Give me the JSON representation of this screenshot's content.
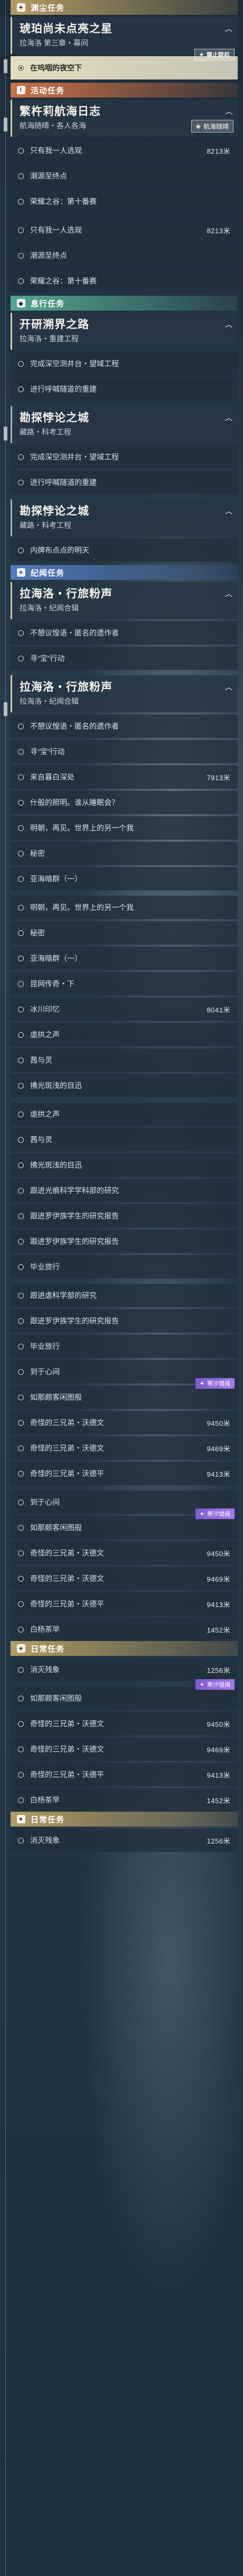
{
  "sections": [
    {
      "type": "cat",
      "style": "cat-main",
      "badge": "✦",
      "label": "渊尘任务"
    },
    {
      "type": "quest",
      "title": "琥珀尚未点亮之星",
      "sub": "拉海洛 第三章・幕间",
      "dim": false
    },
    {
      "type": "row",
      "text": "在呜咽的夜空下",
      "hl": true,
      "tag": {
        "style": "tag-white",
        "text": "禁止联机"
      }
    },
    {
      "type": "space"
    },
    {
      "type": "cat",
      "style": "cat-event",
      "badge": "!",
      "label": "活动任务"
    },
    {
      "type": "quest",
      "title": "繁杵莉航海日志",
      "sub": "航海随晴・各人各海",
      "dim": false,
      "tag": {
        "style": "tag-white",
        "text": "航海随晴"
      }
    },
    {
      "type": "row",
      "text": "只有我一人选观",
      "dist": "8213米"
    },
    {
      "type": "row",
      "text": "潮源至终点"
    },
    {
      "type": "row",
      "text": "荣耀之谷：第十番赛"
    },
    {
      "type": "space"
    },
    {
      "type": "row",
      "text": "只有我一人选观",
      "dist": "8213米"
    },
    {
      "type": "row",
      "text": "潮源至终点"
    },
    {
      "type": "row",
      "text": "荣耀之谷：第十番赛"
    },
    {
      "type": "space"
    },
    {
      "type": "cat",
      "style": "cat-daily",
      "badge": "◆",
      "label": "息行任务"
    },
    {
      "type": "quest",
      "title": "开研溯界之路",
      "sub": "拉海洛・重建工程",
      "dim": false
    },
    {
      "type": "row",
      "text": "完成深空测井台・望域工程"
    },
    {
      "type": "row",
      "text": "进行呼喊隧道的重建"
    },
    {
      "type": "space"
    },
    {
      "type": "quest",
      "title": "勘探悖论之城",
      "sub": "藏路・科考工程",
      "dim": true
    },
    {
      "type": "row",
      "text": "完成深空测井台・望域工程"
    },
    {
      "type": "row",
      "text": "进行呼喊隧道的重建"
    },
    {
      "type": "space"
    },
    {
      "type": "quest",
      "title": "勘探悖论之城",
      "sub": "藏路・科考工程",
      "dim": true
    },
    {
      "type": "row",
      "text": "内牌布点点的明天"
    },
    {
      "type": "space"
    },
    {
      "type": "cat",
      "style": "cat-comp",
      "badge": "✧",
      "label": "纪闻任务"
    },
    {
      "type": "quest",
      "title": "拉海洛・行旅粉声",
      "sub": "拉海洛・纪闻合辑",
      "dim": false
    },
    {
      "type": "row",
      "text": "不憩议惶语・匿名的遗作者"
    },
    {
      "type": "row",
      "text": "寻“宝”行动"
    },
    {
      "type": "space"
    },
    {
      "type": "quest",
      "title": "拉海洛・行旅粉声",
      "sub": "拉海洛・纪闻合辑",
      "dim": false
    },
    {
      "type": "row",
      "text": "不憩议惶语・匿名的遗作者"
    },
    {
      "type": "row",
      "text": "寻“宝”行动"
    },
    {
      "type": "row",
      "text": "来自暮白深处",
      "dist": "7913米"
    },
    {
      "type": "row",
      "text": "什般的照明。谁从睡眠会？"
    },
    {
      "type": "row",
      "text": "明朝，再见。世界上的另一个我"
    },
    {
      "type": "row",
      "text": "秘密"
    },
    {
      "type": "row",
      "text": "亚海暗群（一）"
    },
    {
      "type": "space"
    },
    {
      "type": "row",
      "text": "明朝，再见。世界上的另一个我"
    },
    {
      "type": "row",
      "text": "秘密"
    },
    {
      "type": "row",
      "text": "亚海暗群（一）"
    },
    {
      "type": "row",
      "text": "昆网传奇・下"
    },
    {
      "type": "row",
      "text": "冰川印忆",
      "dist": "8041米"
    },
    {
      "type": "row",
      "text": "虐拱之声"
    },
    {
      "type": "row",
      "text": "茜与灵"
    },
    {
      "type": "row",
      "text": "拂光斑浅的目迅"
    },
    {
      "type": "space"
    },
    {
      "type": "row",
      "text": "虐拱之声"
    },
    {
      "type": "row",
      "text": "茜与灵"
    },
    {
      "type": "row",
      "text": "拂光斑浅的目迅"
    },
    {
      "type": "row",
      "text": "跟进光痕科学学科部的研究"
    },
    {
      "type": "row",
      "text": "跟进罗伊族学生的研究报告"
    },
    {
      "type": "row",
      "text": "跟进罗伊族学生的研究报告"
    },
    {
      "type": "row",
      "text": "毕业旅行"
    },
    {
      "type": "space"
    },
    {
      "type": "row",
      "text": "跟进虐科学部的研究"
    },
    {
      "type": "row",
      "text": "跟进罗伊族学生的研究报告"
    },
    {
      "type": "row",
      "text": "毕业旅行"
    },
    {
      "type": "row",
      "text": "到于心间"
    },
    {
      "type": "row",
      "text": "如那颇客闲图般",
      "tag": {
        "style": "tag-purple",
        "text": "寒汐错阈"
      }
    },
    {
      "type": "row",
      "text": "奇怪的三兄弟・沃德文",
      "dist": "9450米"
    },
    {
      "type": "row",
      "text": "奇怪的三兄弟・沃德文",
      "dist": "9469米"
    },
    {
      "type": "row",
      "text": "奇怪的三兄弟・沃德平",
      "dist": "9413米"
    },
    {
      "type": "space"
    },
    {
      "type": "row",
      "text": "到于心间"
    },
    {
      "type": "row",
      "text": "如那颇客闲图般",
      "tag": {
        "style": "tag-purple",
        "text": "寒汐错阈"
      }
    },
    {
      "type": "row",
      "text": "奇怪的三兄弟・沃德文",
      "dist": "9450米"
    },
    {
      "type": "row",
      "text": "奇怪的三兄弟・沃德文",
      "dist": "9469米"
    },
    {
      "type": "row",
      "text": "奇怪的三兄弟・沃德平",
      "dist": "9413米"
    },
    {
      "type": "row",
      "text": "白杨茶早",
      "dist": "1452米"
    },
    {
      "type": "cat",
      "style": "cat-main",
      "badge": "✦",
      "label": "日常任务"
    },
    {
      "type": "row",
      "text": "消灭残象",
      "dist": "1256米"
    },
    {
      "type": "space"
    },
    {
      "type": "row",
      "text": "如那颇客闲图般",
      "tag": {
        "style": "tag-purple",
        "text": "寒汐错阈"
      }
    },
    {
      "type": "row",
      "text": "奇怪的三兄弟・沃德文",
      "dist": "9450米"
    },
    {
      "type": "row",
      "text": "奇怪的三兄弟・沃德文",
      "dist": "9469米"
    },
    {
      "type": "row",
      "text": "奇怪的三兄弟・沃德平",
      "dist": "9413米"
    },
    {
      "type": "row",
      "text": "白杨茶早",
      "dist": "1452米"
    },
    {
      "type": "cat",
      "style": "cat-main",
      "badge": "✦",
      "label": "日常任务"
    },
    {
      "type": "row",
      "text": "消灭残象",
      "dist": "1256米"
    }
  ]
}
